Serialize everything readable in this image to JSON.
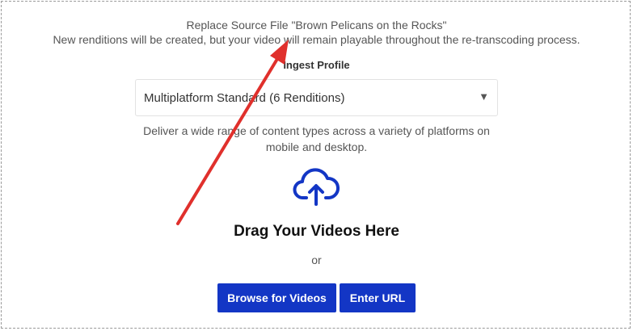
{
  "header": {
    "title": "Replace Source File \"Brown Pelicans on the Rocks\"",
    "subtitle": "New renditions will be created, but your video will remain playable throughout the re-transcoding process."
  },
  "ingest_profile": {
    "label": "Ingest Profile",
    "selected": "Multiplatform Standard (6 Renditions)",
    "arrow": "▼",
    "description": "Deliver a wide range of content types across a variety of platforms on mobile and desktop."
  },
  "upload": {
    "icon": "cloud-upload-icon",
    "drag_text": "Drag Your Videos Here",
    "or_text": "or",
    "browse_label": "Browse for Videos",
    "url_label": "Enter URL"
  },
  "colors": {
    "accent": "#1336c5",
    "annotation_arrow": "#e0302c"
  }
}
